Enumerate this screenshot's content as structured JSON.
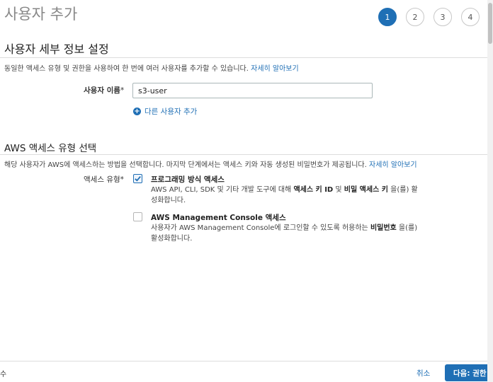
{
  "header": {
    "title": "사용자 추가"
  },
  "steps": [
    "1",
    "2",
    "3",
    "4"
  ],
  "details_section": {
    "title": "사용자 세부 정보 설정",
    "description": "동일한 액세스 유형 및 권한을 사용하여 한 번에 여러 사용자를 추가할 수 있습니다.",
    "learn_more": "자세히 알아보기",
    "username_label": "사용자 이름",
    "required_mark": "*",
    "username_value": "s3-user",
    "add_user_link": "다른 사용자 추가"
  },
  "access_section": {
    "title": "AWS 액세스 유형 선택",
    "description": "해당 사용자가 AWS에 액세스하는 방법을 선택합니다. 마지막 단계에서는 액세스 키와 자동 생성된 비밀번호가 제공됩니다.",
    "learn_more": "자세히 알아보기",
    "access_type_label": "액세스 유형",
    "required_mark": "*",
    "options": [
      {
        "title": "프로그래밍 방식 액세스",
        "checked": true,
        "desc_line1_pre": "AWS API, CLI, SDK 및 기타 개발 도구에 대해 ",
        "desc_bold1": "액세스 키 ID",
        "desc_mid": " 및 ",
        "desc_bold2": "비밀 액세스 키",
        "desc_post": " 을(를) 활",
        "desc_line2": "성화합니다."
      },
      {
        "title": "AWS Management Console 액세스",
        "checked": false,
        "desc_line1_pre": "사용자가 AWS Management Console에 로그인할 수 있도록 허용하는 ",
        "desc_bold1": "비밀번호",
        "desc_post": " 을(를)",
        "desc_line2": "활성화합니다."
      }
    ]
  },
  "footer": {
    "left_text": "수",
    "cancel_label": "취소",
    "next_label": "다음: 권한"
  },
  "colors": {
    "accent": "#1f6fb5",
    "title_gray": "#888888",
    "divider": "#dddddd"
  }
}
